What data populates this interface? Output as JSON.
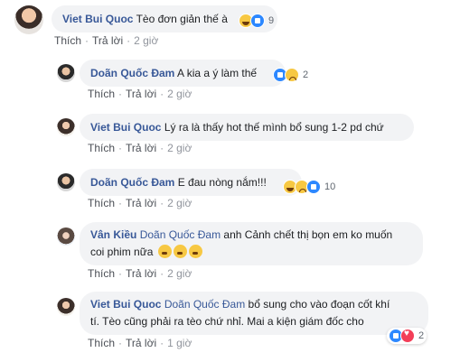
{
  "actions": {
    "like": "Thích",
    "reply": "Trả lời"
  },
  "comments": [
    {
      "author": "Viet Bui Quoc",
      "text": "Tèo đơn giản thế à",
      "time": "2 giờ",
      "reaction_count": "9",
      "reactions": [
        "haha-icon",
        "like-icon"
      ]
    },
    {
      "author": "Doãn Quốc Đam",
      "text": "A kia a ý làm thế",
      "time": "2 giờ",
      "reaction_count": "2",
      "reactions": [
        "like-icon",
        "sad-icon"
      ]
    },
    {
      "author": "Viet Bui Quoc",
      "text": "Lý ra là thấy hot thế mình bổ sung 1-2 pd chứ",
      "time": "2 giờ"
    },
    {
      "author": "Doãn Quốc Đam",
      "text": "E đau nòng nắm!!!",
      "time": "2 giờ",
      "reaction_count": "10",
      "reactions": [
        "haha-icon",
        "sad-icon",
        "like-icon"
      ]
    },
    {
      "author": "Vân Kiều",
      "mention": "Doãn Quốc Đam",
      "text_line1": "anh Cảnh chết thị bọn em ko muốn",
      "text_line2": "coi phim nữa",
      "time": "2 giờ",
      "inline_emojis": [
        "surprised-emoji",
        "surprised-emoji",
        "surprised-emoji"
      ]
    },
    {
      "author": "Viet Bui Quoc",
      "mention": "Doãn Quốc Đam",
      "text_line1": "bổ sung cho vào đoạn cốt khí",
      "text_line2": "tí. Tèo cũng phải ra tèo chứ nhỉ. Mai a kiện giám đốc cho",
      "time": "1 giờ",
      "reaction_count": "2",
      "reactions": [
        "like-icon",
        "love-icon"
      ]
    }
  ]
}
